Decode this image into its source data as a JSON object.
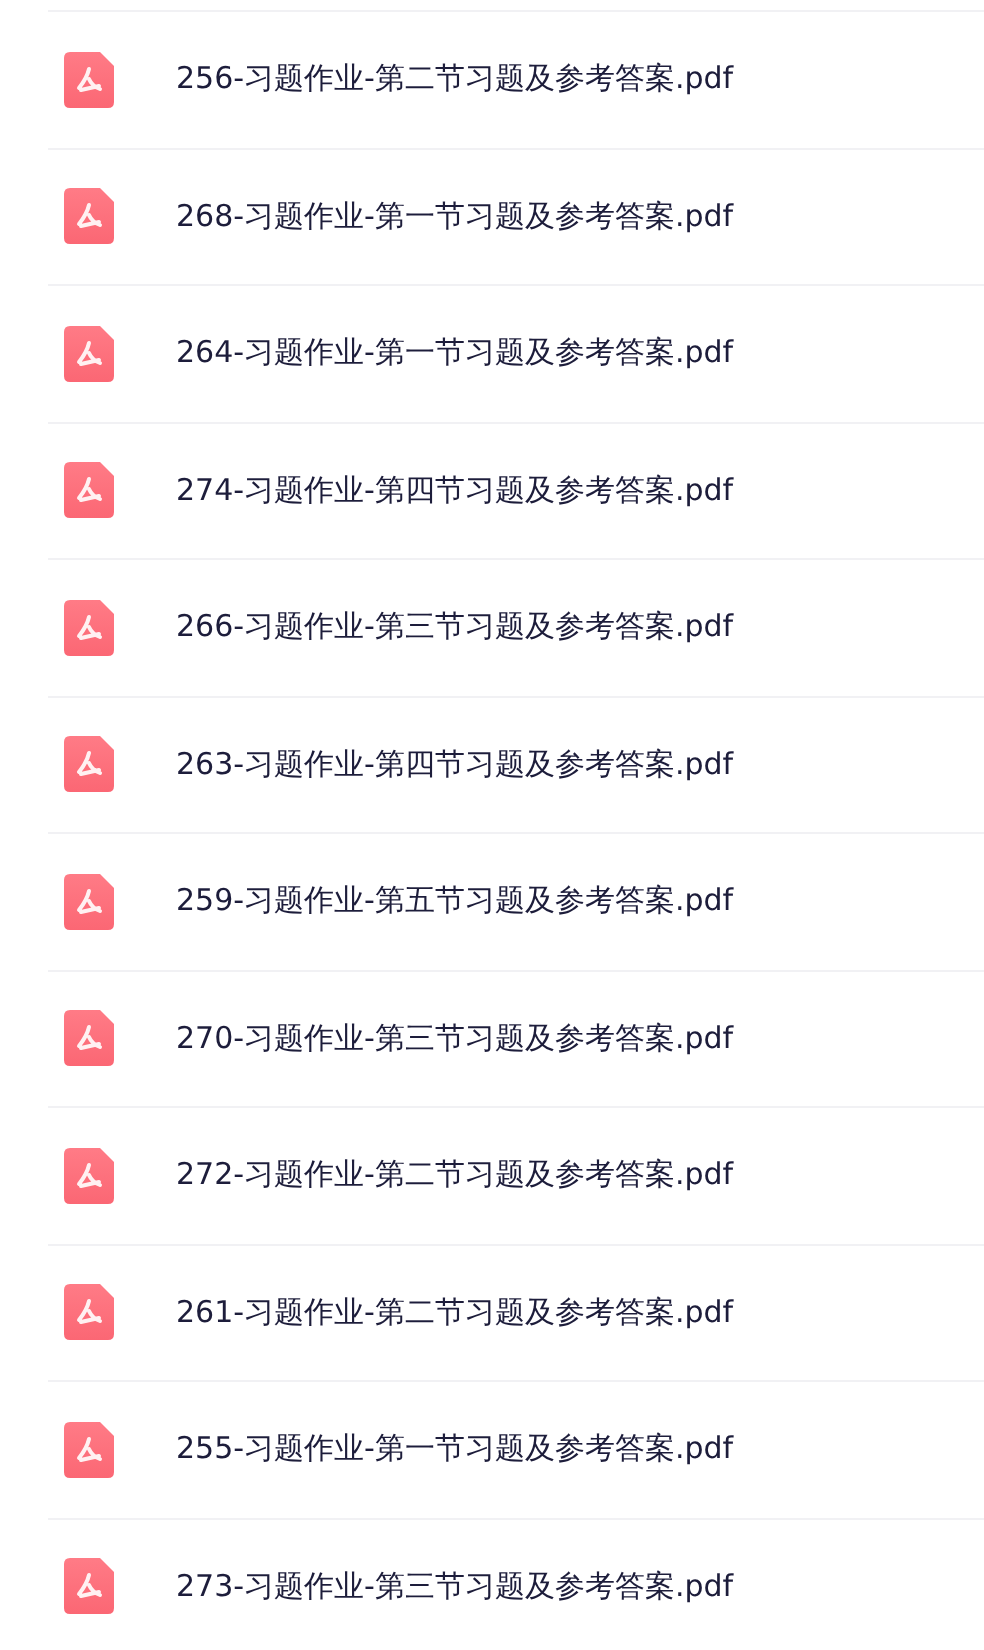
{
  "files": [
    {
      "name": "256-习题作业-第二节习题及参考答案.pdf"
    },
    {
      "name": "268-习题作业-第一节习题及参考答案.pdf"
    },
    {
      "name": "264-习题作业-第一节习题及参考答案.pdf"
    },
    {
      "name": "274-习题作业-第四节习题及参考答案.pdf"
    },
    {
      "name": "266-习题作业-第三节习题及参考答案.pdf"
    },
    {
      "name": "263-习题作业-第四节习题及参考答案.pdf"
    },
    {
      "name": "259-习题作业-第五节习题及参考答案.pdf"
    },
    {
      "name": "270-习题作业-第三节习题及参考答案.pdf"
    },
    {
      "name": "272-习题作业-第二节习题及参考答案.pdf"
    },
    {
      "name": "261-习题作业-第二节习题及参考答案.pdf"
    },
    {
      "name": "255-习题作业-第一节习题及参考答案.pdf"
    },
    {
      "name": "273-习题作业-第三节习题及参考答案.pdf"
    }
  ]
}
